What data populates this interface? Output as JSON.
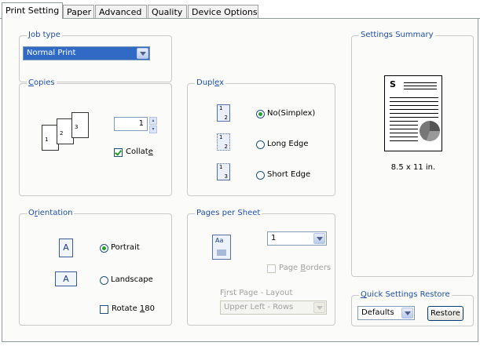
{
  "tabs": [
    {
      "label": "Print Setting",
      "active": true
    },
    {
      "label": "Paper",
      "active": false
    },
    {
      "label": "Advanced",
      "active": false
    },
    {
      "label": "Quality",
      "active": false
    },
    {
      "label": "Device Options",
      "active": false
    }
  ],
  "job_type": {
    "legend_pre": "",
    "legend_u": "J",
    "legend_post": "ob type",
    "value": "Normal Print"
  },
  "copies": {
    "legend_pre": "",
    "legend_u": "C",
    "legend_post": "opies",
    "count": "1",
    "collate_pre": "Collat",
    "collate_u": "e",
    "collate_post": "",
    "collate_checked": true,
    "page_numbers": [
      "1",
      "2",
      "3"
    ]
  },
  "duplex": {
    "legend_pre": "Dupl",
    "legend_u": "e",
    "legend_post": "x",
    "options": [
      {
        "label": "No(Simplex)",
        "selected": true
      },
      {
        "label": "Long Edge",
        "selected": false
      },
      {
        "label": "Short Edge",
        "selected": false
      }
    ],
    "icon_numbers": [
      "1",
      "2",
      "1",
      "2",
      "1",
      "3"
    ]
  },
  "orientation": {
    "legend_pre": "O",
    "legend_u": "r",
    "legend_post": "ientation",
    "portrait": "Portrait",
    "landscape": "Landscape",
    "portrait_selected": true,
    "rotate_pre": "Rotate ",
    "rotate_u": "1",
    "rotate_post": "80",
    "rotate_checked": false,
    "icon_letter": "A"
  },
  "pages_per_sheet": {
    "legend": "Pages per Sheet",
    "value": "1",
    "borders_pre": "Page ",
    "borders_u": "B",
    "borders_post": "orders",
    "first_page_pre": "F",
    "first_page_u": "i",
    "first_page_post": "rst Page - Layout",
    "layout_value": "Upper Left - Rows",
    "icon_text": "Aa"
  },
  "summary": {
    "legend": "Settings Summary",
    "preview_letter": "S",
    "paper_size": "8.5 x 11 in."
  },
  "quick_restore": {
    "legend_pre": "",
    "legend_u": "Q",
    "legend_post": "uick Settings Restore",
    "value": "Defaults",
    "restore_label": "Restore"
  },
  "colors": {
    "accent": "#1e4ea8",
    "select_bg": "#316ac5",
    "radio_dot": "#21a121"
  }
}
